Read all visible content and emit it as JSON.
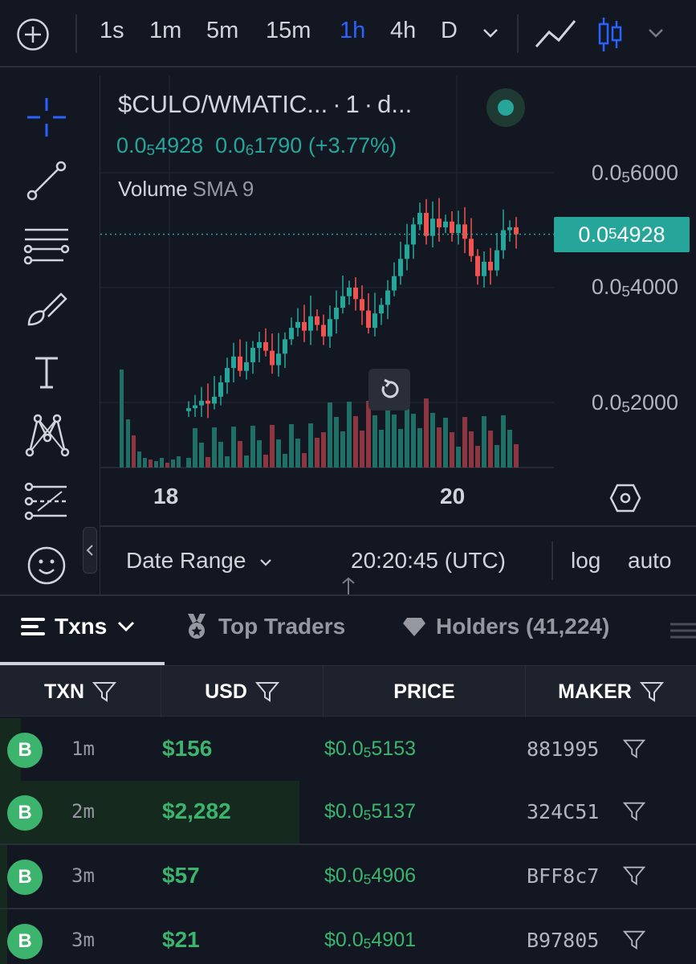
{
  "toolbar": {
    "timeframes": [
      "1s",
      "1m",
      "5m",
      "15m",
      "1h",
      "4h",
      "D"
    ],
    "active_timeframe": "1h"
  },
  "chart": {
    "symbol": "$CULO/WMATIC...",
    "interval": "1",
    "exchange": "d...",
    "price_prefix": "0.0",
    "price_sub": "5",
    "price_rest": "4928",
    "change_prefix": "0.0",
    "change_sub": "6",
    "change_rest": "1790",
    "change_pct": "(+3.77%)",
    "volume_label": "Volume",
    "sma_label": "SMA 9",
    "y_labels": [
      {
        "prefix": "0.0",
        "sub": "5",
        "rest": "6000"
      },
      {
        "prefix": "0.0",
        "sub": "5",
        "rest": "4000"
      },
      {
        "prefix": "0.0",
        "sub": "5",
        "rest": "2000"
      }
    ],
    "last_price": {
      "prefix": "0.0",
      "sub": "5",
      "rest": "4928"
    },
    "x_labels": [
      "18",
      "20"
    ],
    "date_range": "Date Range",
    "utc_time": "20:20:45 (UTC)",
    "log_label": "log",
    "auto_label": "auto",
    "colors": {
      "up": "#26a69a",
      "down": "#ef5350",
      "up_vol": "#1f6f66",
      "down_vol": "#8b3640"
    }
  },
  "tabs": {
    "txns": "Txns",
    "top_traders": "Top Traders",
    "holders": "Holders (41,224)"
  },
  "table": {
    "headers": {
      "txn": "TXN",
      "usd": "USD",
      "price": "PRICE",
      "maker": "MAKER"
    },
    "rows": [
      {
        "badge": "B",
        "age": "1m",
        "usd": "$156",
        "price_prefix": "$0.0",
        "price_sub": "5",
        "price_rest": "5153",
        "maker": "881995",
        "fill": 0.03
      },
      {
        "badge": "B",
        "age": "2m",
        "usd": "$2,282",
        "price_prefix": "$0.0",
        "price_sub": "5",
        "price_rest": "5137",
        "maker": "324C51",
        "fill": 0.43
      },
      {
        "badge": "B",
        "age": "3m",
        "usd": "$57",
        "price_prefix": "$0.0",
        "price_sub": "5",
        "price_rest": "4906",
        "maker": "BFF8c7",
        "fill": 0.01
      },
      {
        "badge": "B",
        "age": "3m",
        "usd": "$21",
        "price_prefix": "$0.0",
        "price_sub": "5",
        "price_rest": "4901",
        "maker": "B97805",
        "fill": 0.01
      }
    ]
  }
}
